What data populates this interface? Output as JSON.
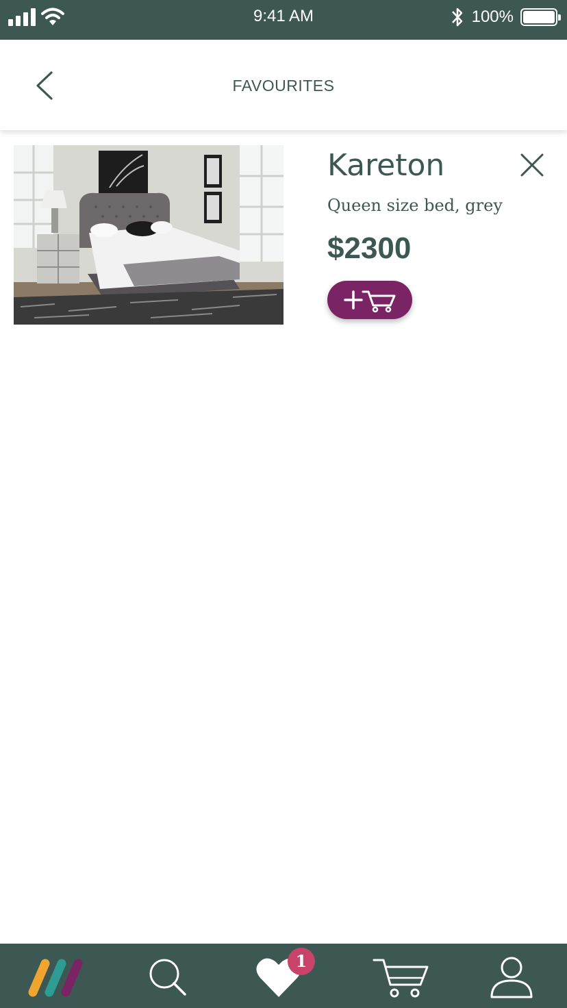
{
  "status_bar": {
    "time": "9:41 AM",
    "battery": "100%",
    "icons": [
      "signal-icon",
      "wifi-icon",
      "bluetooth-icon",
      "battery-icon"
    ]
  },
  "header": {
    "title": "FAVOURITES",
    "back_icon": "chevron-left-icon"
  },
  "favourites": [
    {
      "name": "Kareton",
      "description": "Queen size bed, grey",
      "price": "$2300",
      "image": "grey tufted queen bed in bedroom",
      "remove_icon": "close-icon",
      "add_to_cart_icon": "add-to-cart-icon"
    }
  ],
  "tab_bar": {
    "items": [
      "logo-icon",
      "search-icon",
      "heart-icon",
      "cart-icon",
      "profile-icon"
    ],
    "active": "heart-icon",
    "favourites_badge": "1"
  },
  "colors": {
    "primary": "#3d5753",
    "accent": "#7a2466",
    "badge": "#c8436a",
    "background": "#ffffff"
  }
}
